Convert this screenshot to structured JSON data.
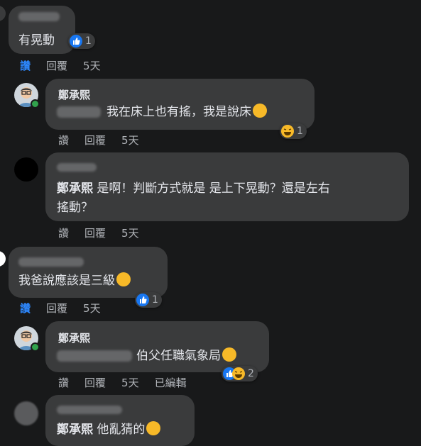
{
  "comments": [
    {
      "author_blurred": true,
      "text": "有晃動",
      "reactions": {
        "icons": [
          "like-icon"
        ],
        "count": "1"
      },
      "actions": {
        "like": "讚",
        "reply": "回覆",
        "time": "5天"
      }
    },
    {
      "author": "鄭承熙",
      "text": "我在床上也有搖，我是說床",
      "reactions": {
        "icons": [
          "haha-icon"
        ],
        "count": "1"
      },
      "actions": {
        "like": "讚",
        "reply": "回覆",
        "time": "5天"
      }
    },
    {
      "author_blurred": true,
      "author_in_text": "鄭承熙",
      "text_line1": "是啊！判斷方式就是 是上下晃動？還是左右",
      "text_line2": "搖動？",
      "actions": {
        "like": "讚",
        "reply": "回覆",
        "time": "5天"
      }
    },
    {
      "author_blurred": true,
      "text": "我爸說應該是三級",
      "reactions": {
        "icons": [
          "like-icon"
        ],
        "count": "1"
      },
      "actions": {
        "like": "讚",
        "reply": "回覆",
        "time": "5天"
      }
    },
    {
      "author": "鄭承熙",
      "text": "伯父任職氣象局",
      "reactions": {
        "icons": [
          "like-icon",
          "haha-icon"
        ],
        "count": "2"
      },
      "actions": {
        "like": "讚",
        "reply": "回覆",
        "time": "5天",
        "edited": "已編輯"
      }
    },
    {
      "author_blurred": true,
      "author_in_text": "鄭承熙",
      "text": "他亂猜的"
    }
  ],
  "colors": {
    "background": "#18191a",
    "bubble": "#3a3b3c",
    "text": "#e4e6eb",
    "muted": "#b0b3b8",
    "link": "#2d88ff"
  }
}
